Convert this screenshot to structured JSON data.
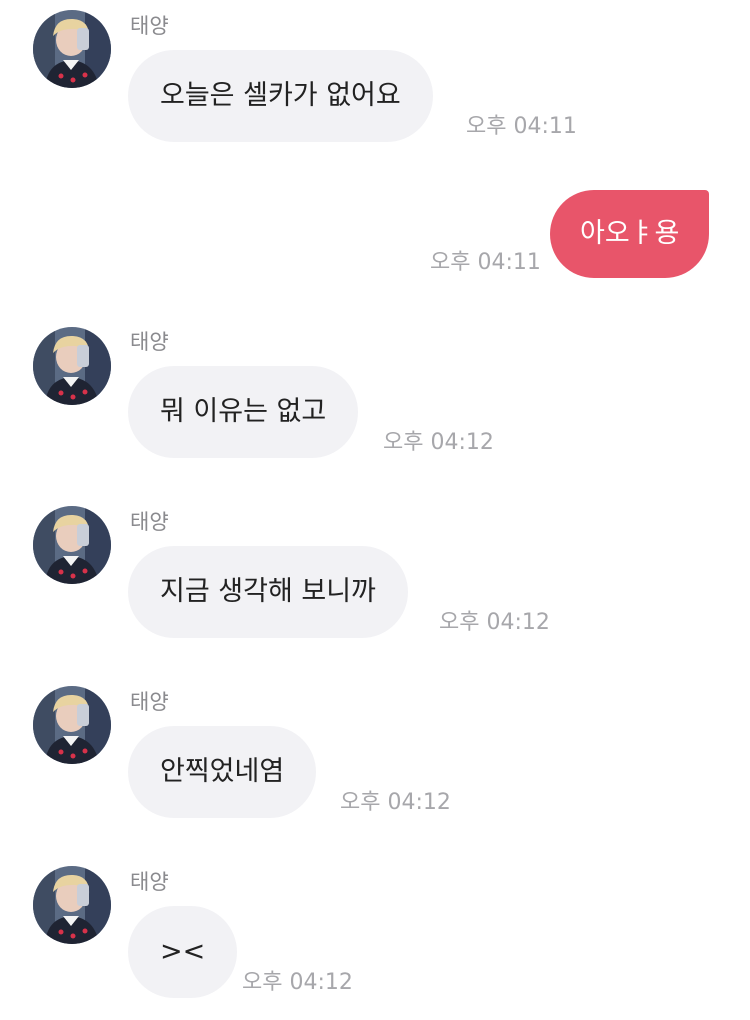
{
  "messages": [
    {
      "direction": "incoming",
      "sender": "태양",
      "text": "오늘은 셀카가 없어요",
      "time": "오후 04:11"
    },
    {
      "direction": "outgoing",
      "text": "아오ㅑ용",
      "time": "오후 04:11"
    },
    {
      "direction": "incoming",
      "sender": "태양",
      "text": "뭐 이유는 없고",
      "time": "오후 04:12"
    },
    {
      "direction": "incoming",
      "sender": "태양",
      "text": "지금 생각해 보니까",
      "time": "오후 04:12"
    },
    {
      "direction": "incoming",
      "sender": "태양",
      "text": "안찍었네염",
      "time": "오후 04:12"
    },
    {
      "direction": "incoming",
      "sender": "태양",
      "text": "><",
      "time": "오후 04:12"
    }
  ],
  "colors": {
    "incoming_bubble": "#f2f2f5",
    "outgoing_bubble": "#e8556a",
    "timestamp": "#a7a7ab",
    "sender_name": "#8a8a8e"
  },
  "icons": {
    "avatar": "profile-photo"
  }
}
